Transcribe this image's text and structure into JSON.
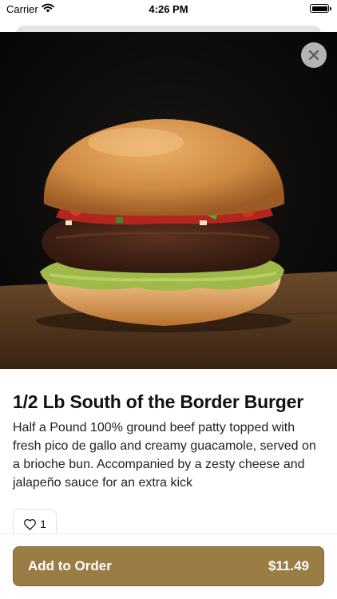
{
  "status_bar": {
    "carrier": "Carrier",
    "time": "4:26 PM"
  },
  "item": {
    "title": "1/2 Lb South of the Border Burger",
    "description": "Half a Pound 100% ground beef patty topped with fresh pico de gallo and creamy guacamole, served on a brioche bun. Accompanied by a zesty cheese and jalapeño sauce for an extra kick",
    "likes": "1"
  },
  "actions": {
    "add_to_order": "Add to Order",
    "price": "$11.49"
  },
  "icons": {
    "close": "close-icon",
    "like": "heart-icon",
    "wifi": "wifi-icon",
    "battery": "battery-icon"
  },
  "colors": {
    "accent": "#9a7d45",
    "accent_border": "#7d6333"
  }
}
